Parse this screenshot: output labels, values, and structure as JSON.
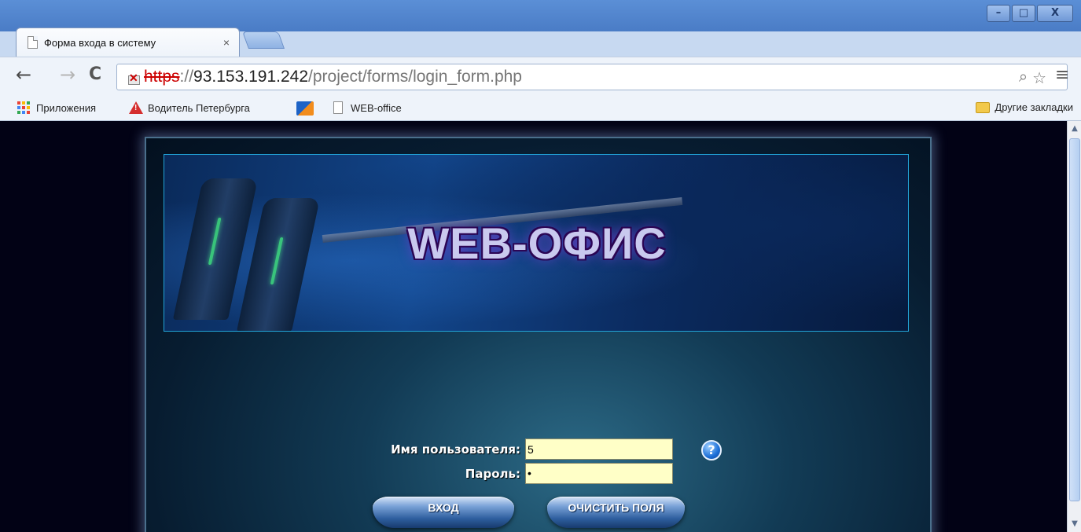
{
  "browser": {
    "tab_title": "Форма входа в систему",
    "tab_close": "×",
    "window_controls": {
      "minimize": "–",
      "maximize": "□",
      "close": "X"
    },
    "nav": {
      "back": "←",
      "forward": "→",
      "reload": "C",
      "menu": "≡"
    },
    "url": {
      "scheme": "https",
      "separator": "://",
      "host": "93.153.191.242",
      "path": "/project/forms/login_form.php"
    },
    "bookmarks": [
      "Приложения",
      "Водитель Петербурга",
      "",
      "WEB-office"
    ],
    "other_bookmarks": "Другие закладки",
    "icons": {
      "zoom": "search-icon",
      "star": "star-icon"
    }
  },
  "page": {
    "banner_title": "WEB-ОФИС",
    "username_label": "Имя пользователя:",
    "username_value": "5",
    "password_label": "Пароль:",
    "password_value": "•",
    "help_symbol": "?",
    "login_button": "ВХОД",
    "clear_button": "ОЧИСТИТЬ ПОЛЯ"
  },
  "colors": {
    "input_bg": "#ffffc7",
    "page_bg": "#020215",
    "banner_border": "#22a4d8"
  }
}
